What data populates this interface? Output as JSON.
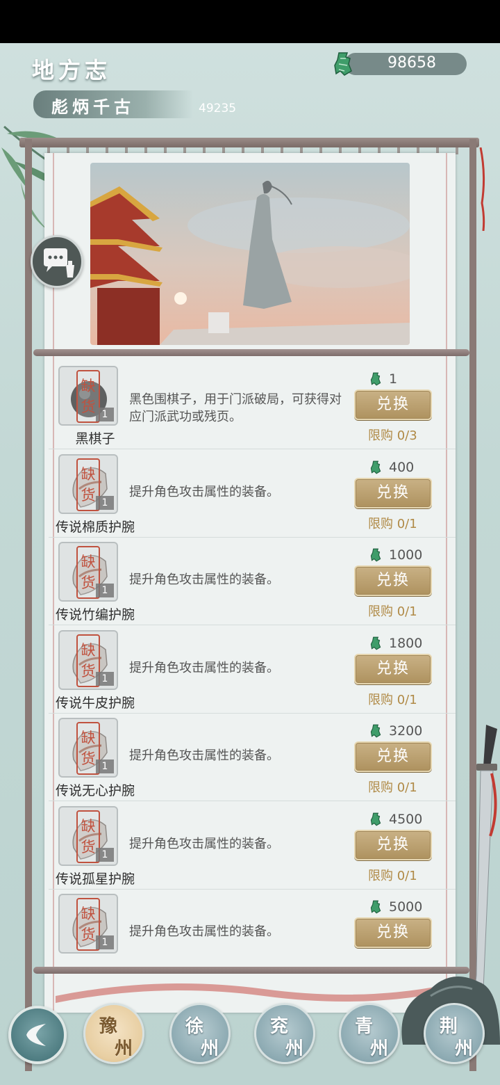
{
  "header": {
    "title": "地方志",
    "subtitle": "彪炳千古",
    "subtitle_score": "49235",
    "currency_icon": "jade-pendant-icon",
    "currency_amount": "98658"
  },
  "colors": {
    "accent_gold": "#ae925f",
    "limit_text": "#b08a46",
    "stamp_red": "#c0523f",
    "price_icon_green": "#3f9d6a"
  },
  "stamp_text": "缺货",
  "exchange_label": "兑换",
  "items": [
    {
      "name": "黑棋子",
      "desc": "黑色围棋子，用于门派破局，可获得对应门派武功或残页。",
      "qty": "1",
      "price": "1",
      "limit": "限购 0/3",
      "icon": "black-go-piece-icon"
    },
    {
      "name": "传说棉质护腕",
      "desc": "提升角色攻击属性的装备。",
      "qty": "1",
      "price": "400",
      "limit": "限购 0/1",
      "icon": "wrist-guard-icon"
    },
    {
      "name": "传说竹编护腕",
      "desc": "提升角色攻击属性的装备。",
      "qty": "1",
      "price": "1000",
      "limit": "限购 0/1",
      "icon": "wrist-guard-icon"
    },
    {
      "name": "传说牛皮护腕",
      "desc": "提升角色攻击属性的装备。",
      "qty": "1",
      "price": "1800",
      "limit": "限购 0/1",
      "icon": "wrist-guard-icon"
    },
    {
      "name": "传说无心护腕",
      "desc": "提升角色攻击属性的装备。",
      "qty": "1",
      "price": "3200",
      "limit": "限购 0/1",
      "icon": "wrist-guard-icon"
    },
    {
      "name": "传说孤星护腕",
      "desc": "提升角色攻击属性的装备。",
      "qty": "1",
      "price": "4500",
      "limit": "限购 0/1",
      "icon": "wrist-guard-icon"
    },
    {
      "name": "",
      "desc": "提升角色攻击属性的装备。",
      "qty": "1",
      "price": "5000",
      "limit": "",
      "icon": "wrist-guard-icon"
    }
  ],
  "regions": [
    {
      "c1": "豫",
      "c2": "州",
      "active": true
    },
    {
      "c1": "徐",
      "c2": "州",
      "active": false
    },
    {
      "c1": "兖",
      "c2": "州",
      "active": false
    },
    {
      "c1": "青",
      "c2": "州",
      "active": false
    },
    {
      "c1": "荆",
      "c2": "州",
      "active": false
    }
  ]
}
